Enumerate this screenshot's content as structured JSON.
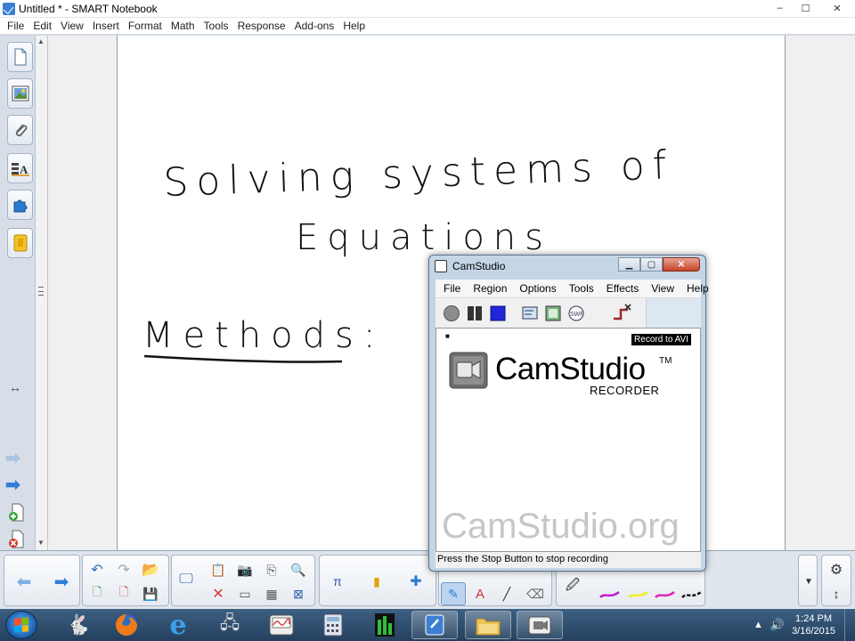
{
  "window": {
    "title": "Untitled * - SMART Notebook",
    "controls": {
      "minimize": "–",
      "maximize": "☐",
      "close": "✕"
    }
  },
  "menubar": {
    "items": [
      "File",
      "Edit",
      "View",
      "Insert",
      "Format",
      "Math",
      "Tools",
      "Response",
      "Add-ons",
      "Help"
    ]
  },
  "sidebar": {
    "tabs": [
      "page-sorter",
      "gallery",
      "attachments",
      "properties",
      "add-ons",
      "response"
    ]
  },
  "canvas": {
    "heading_line1": "Solving systems of",
    "heading_line2": "Equations",
    "methods_label": "Methods:"
  },
  "camstudio": {
    "title": "CamStudio",
    "menu": [
      "File",
      "Region",
      "Options",
      "Tools",
      "Effects",
      "View",
      "Help"
    ],
    "record_label": "Record to AVI",
    "logo_text": "CamStudio",
    "logo_tm": "TM",
    "logo_sub": "RECORDER",
    "watermark": "CamStudio.org",
    "status": "Press the Stop Button to stop recording"
  },
  "taskbar": {
    "time": "1:24 PM",
    "date": "3/16/2015"
  },
  "colors": {
    "pen_purple": "#c01bd0",
    "pen_yellow": "#f2ee1c",
    "pen_magenta": "#e61fb5",
    "pen_black": "#111111",
    "nav_arrow": "#2f7ed8",
    "record_blue": "#2424d8"
  }
}
